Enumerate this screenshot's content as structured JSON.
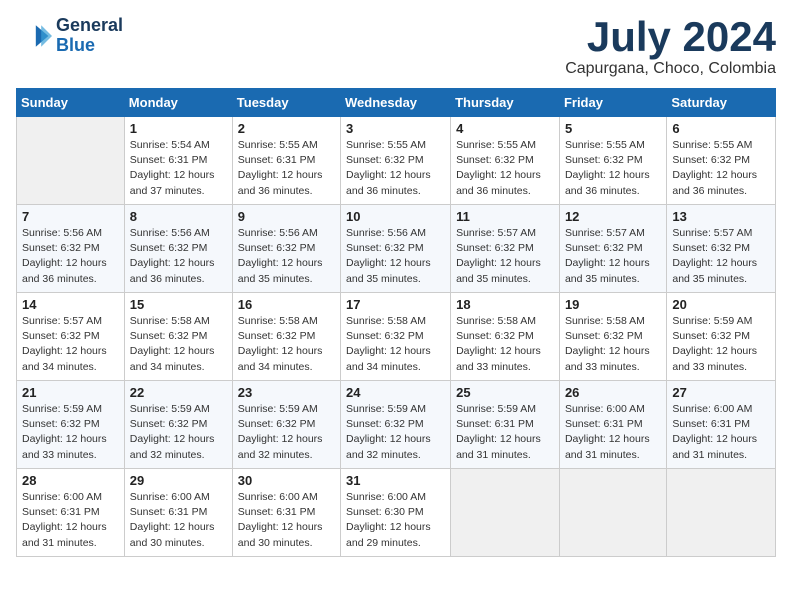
{
  "header": {
    "logo_line1": "General",
    "logo_line2": "Blue",
    "month": "July 2024",
    "location": "Capurgana, Choco, Colombia"
  },
  "days_of_week": [
    "Sunday",
    "Monday",
    "Tuesday",
    "Wednesday",
    "Thursday",
    "Friday",
    "Saturday"
  ],
  "weeks": [
    [
      {
        "day": "",
        "info": ""
      },
      {
        "day": "1",
        "info": "Sunrise: 5:54 AM\nSunset: 6:31 PM\nDaylight: 12 hours\nand 37 minutes."
      },
      {
        "day": "2",
        "info": "Sunrise: 5:55 AM\nSunset: 6:31 PM\nDaylight: 12 hours\nand 36 minutes."
      },
      {
        "day": "3",
        "info": "Sunrise: 5:55 AM\nSunset: 6:32 PM\nDaylight: 12 hours\nand 36 minutes."
      },
      {
        "day": "4",
        "info": "Sunrise: 5:55 AM\nSunset: 6:32 PM\nDaylight: 12 hours\nand 36 minutes."
      },
      {
        "day": "5",
        "info": "Sunrise: 5:55 AM\nSunset: 6:32 PM\nDaylight: 12 hours\nand 36 minutes."
      },
      {
        "day": "6",
        "info": "Sunrise: 5:55 AM\nSunset: 6:32 PM\nDaylight: 12 hours\nand 36 minutes."
      }
    ],
    [
      {
        "day": "7",
        "info": "Sunrise: 5:56 AM\nSunset: 6:32 PM\nDaylight: 12 hours\nand 36 minutes."
      },
      {
        "day": "8",
        "info": "Sunrise: 5:56 AM\nSunset: 6:32 PM\nDaylight: 12 hours\nand 36 minutes."
      },
      {
        "day": "9",
        "info": "Sunrise: 5:56 AM\nSunset: 6:32 PM\nDaylight: 12 hours\nand 35 minutes."
      },
      {
        "day": "10",
        "info": "Sunrise: 5:56 AM\nSunset: 6:32 PM\nDaylight: 12 hours\nand 35 minutes."
      },
      {
        "day": "11",
        "info": "Sunrise: 5:57 AM\nSunset: 6:32 PM\nDaylight: 12 hours\nand 35 minutes."
      },
      {
        "day": "12",
        "info": "Sunrise: 5:57 AM\nSunset: 6:32 PM\nDaylight: 12 hours\nand 35 minutes."
      },
      {
        "day": "13",
        "info": "Sunrise: 5:57 AM\nSunset: 6:32 PM\nDaylight: 12 hours\nand 35 minutes."
      }
    ],
    [
      {
        "day": "14",
        "info": "Sunrise: 5:57 AM\nSunset: 6:32 PM\nDaylight: 12 hours\nand 34 minutes."
      },
      {
        "day": "15",
        "info": "Sunrise: 5:58 AM\nSunset: 6:32 PM\nDaylight: 12 hours\nand 34 minutes."
      },
      {
        "day": "16",
        "info": "Sunrise: 5:58 AM\nSunset: 6:32 PM\nDaylight: 12 hours\nand 34 minutes."
      },
      {
        "day": "17",
        "info": "Sunrise: 5:58 AM\nSunset: 6:32 PM\nDaylight: 12 hours\nand 34 minutes."
      },
      {
        "day": "18",
        "info": "Sunrise: 5:58 AM\nSunset: 6:32 PM\nDaylight: 12 hours\nand 33 minutes."
      },
      {
        "day": "19",
        "info": "Sunrise: 5:58 AM\nSunset: 6:32 PM\nDaylight: 12 hours\nand 33 minutes."
      },
      {
        "day": "20",
        "info": "Sunrise: 5:59 AM\nSunset: 6:32 PM\nDaylight: 12 hours\nand 33 minutes."
      }
    ],
    [
      {
        "day": "21",
        "info": "Sunrise: 5:59 AM\nSunset: 6:32 PM\nDaylight: 12 hours\nand 33 minutes."
      },
      {
        "day": "22",
        "info": "Sunrise: 5:59 AM\nSunset: 6:32 PM\nDaylight: 12 hours\nand 32 minutes."
      },
      {
        "day": "23",
        "info": "Sunrise: 5:59 AM\nSunset: 6:32 PM\nDaylight: 12 hours\nand 32 minutes."
      },
      {
        "day": "24",
        "info": "Sunrise: 5:59 AM\nSunset: 6:32 PM\nDaylight: 12 hours\nand 32 minutes."
      },
      {
        "day": "25",
        "info": "Sunrise: 5:59 AM\nSunset: 6:31 PM\nDaylight: 12 hours\nand 31 minutes."
      },
      {
        "day": "26",
        "info": "Sunrise: 6:00 AM\nSunset: 6:31 PM\nDaylight: 12 hours\nand 31 minutes."
      },
      {
        "day": "27",
        "info": "Sunrise: 6:00 AM\nSunset: 6:31 PM\nDaylight: 12 hours\nand 31 minutes."
      }
    ],
    [
      {
        "day": "28",
        "info": "Sunrise: 6:00 AM\nSunset: 6:31 PM\nDaylight: 12 hours\nand 31 minutes."
      },
      {
        "day": "29",
        "info": "Sunrise: 6:00 AM\nSunset: 6:31 PM\nDaylight: 12 hours\nand 30 minutes."
      },
      {
        "day": "30",
        "info": "Sunrise: 6:00 AM\nSunset: 6:31 PM\nDaylight: 12 hours\nand 30 minutes."
      },
      {
        "day": "31",
        "info": "Sunrise: 6:00 AM\nSunset: 6:30 PM\nDaylight: 12 hours\nand 29 minutes."
      },
      {
        "day": "",
        "info": ""
      },
      {
        "day": "",
        "info": ""
      },
      {
        "day": "",
        "info": ""
      }
    ]
  ]
}
